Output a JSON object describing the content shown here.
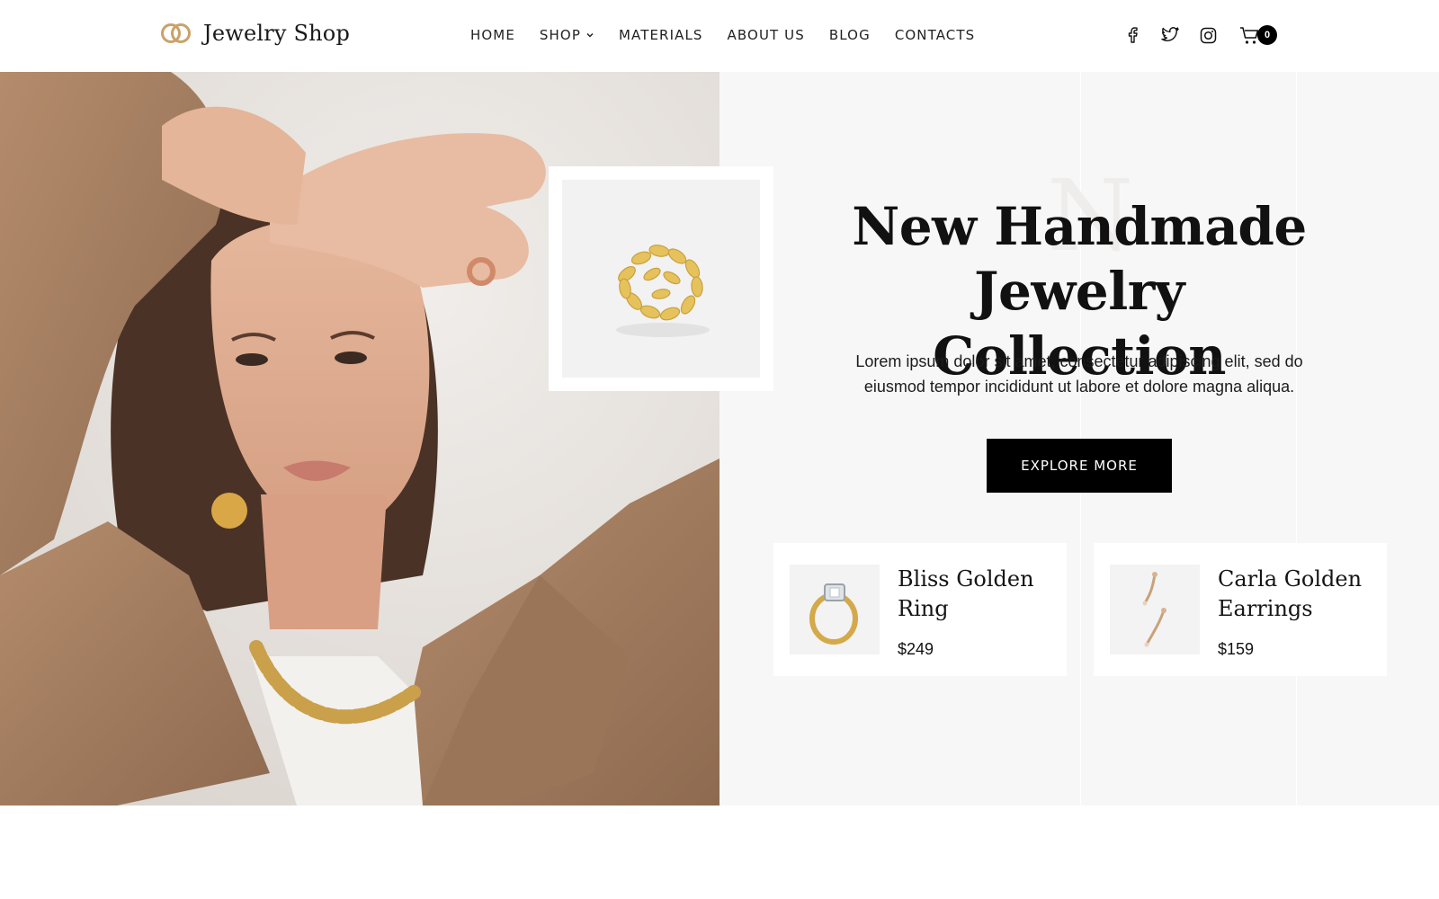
{
  "header": {
    "logo_text": "Jewelry Shop",
    "nav": [
      {
        "label": "HOME"
      },
      {
        "label": "SHOP"
      },
      {
        "label": "MATERIALS"
      },
      {
        "label": "ABOUT US"
      },
      {
        "label": "BLOG"
      },
      {
        "label": "CONTACTS"
      }
    ],
    "social_icons": [
      "facebook-icon",
      "twitter-icon",
      "instagram-icon"
    ],
    "cart_count": "0"
  },
  "hero": {
    "ghost_letter": "N",
    "title_line1": "New Handmade",
    "title_line2": "Jewelry Collection",
    "description": "Lorem ipsum dolor sit amet, consectetur adipiscing elit, sed do eiusmod tempor incididunt ut labore et dolore magna aliqua.",
    "cta_label": "EXPLORE MORE"
  },
  "products": [
    {
      "name_line1": "Bliss Golden",
      "name_line2": "Ring",
      "price": "$249"
    },
    {
      "name_line1": "Carla Golden",
      "name_line2": "Earrings",
      "price": "$159"
    }
  ],
  "colors": {
    "gold": "#c9a26a",
    "accent_black": "#000000",
    "panel_bg": "#f8f7f7",
    "jacket": "#a98062"
  }
}
